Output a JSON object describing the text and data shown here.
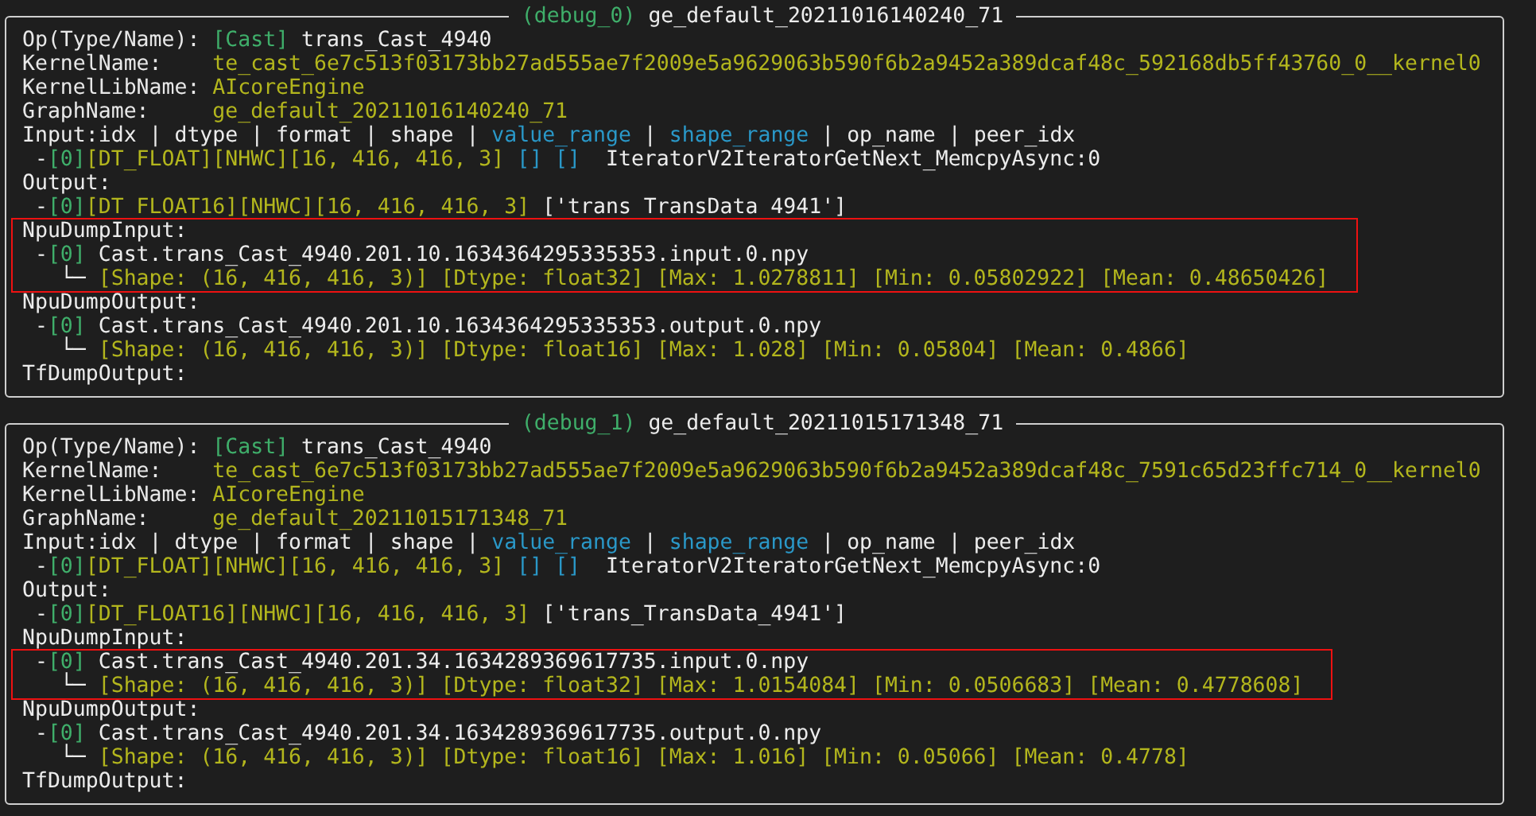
{
  "panels": [
    {
      "legend": [
        {
          "kind": "tag",
          "text": "(debug_0)"
        },
        {
          "kind": "plain",
          "text": "ge_default_20211016140240_71",
          "spaced": true
        }
      ],
      "lines": [
        {
          "kind": "header",
          "segments": [
            {
              "kind": "label",
              "text": "Op(Type/Name):"
            },
            {
              "kind": "tag",
              "text": "[Cast]"
            },
            {
              "kind": "plain",
              "text": "trans_Cast_4940",
              "spaced": true
            }
          ]
        },
        {
          "kind": "header",
          "segments": [
            {
              "kind": "label",
              "text": "KernelName:"
            },
            {
              "kind": "value",
              "text": "te_cast_6e7c513f03173bb27ad555ae7f2009e5a9629063b590f6b2a9452a389dcaf48c_592168db5ff43760_0__kernel0"
            }
          ]
        },
        {
          "kind": "header",
          "segments": [
            {
              "kind": "label",
              "text": "KernelLibName:"
            },
            {
              "kind": "value",
              "text": "AIcoreEngine"
            }
          ]
        },
        {
          "kind": "header",
          "segments": [
            {
              "kind": "label",
              "text": "GraphName:"
            },
            {
              "kind": "value",
              "text": "ge_default_20211016140240_71"
            }
          ]
        },
        {
          "kind": "header",
          "segments": [
            {
              "kind": "plain",
              "text": "Input:idx | dtype | format | shape |"
            },
            {
              "kind": "range",
              "text": "value_range",
              "spaced": true
            },
            {
              "kind": "plain",
              "text": "|",
              "spaced": true
            },
            {
              "kind": "range",
              "text": "shape_range",
              "spaced": true
            },
            {
              "kind": "plain",
              "text": "| op_name | peer_idx",
              "spaced": true
            }
          ]
        },
        {
          "kind": "item",
          "segments": [
            {
              "kind": "plain",
              "text": "-"
            },
            {
              "kind": "tag",
              "text": "[0]"
            },
            {
              "kind": "value",
              "text": "[DT_FLOAT][NHWC][16, 416, 416, 3]"
            },
            {
              "kind": "range",
              "text": "[] []",
              "spaced": true
            },
            {
              "kind": "plain",
              "text": "IteratorV2IteratorGetNext_MemcpyAsync:0",
              "spaced": true,
              "wide": true
            }
          ]
        },
        {
          "kind": "header",
          "segments": [
            {
              "kind": "plain",
              "text": "Output:"
            }
          ]
        },
        {
          "kind": "item",
          "segments": [
            {
              "kind": "plain",
              "text": "-"
            },
            {
              "kind": "tag",
              "text": "[0]"
            },
            {
              "kind": "value",
              "text": "[DT FLOAT16][NHWC][16, 416, 416, 3]"
            },
            {
              "kind": "plain",
              "text": "['trans TransData 4941']",
              "spaced": true
            }
          ]
        },
        {
          "kind": "highlight",
          "lines": [
            {
              "kind": "header",
              "segments": [
                {
                  "kind": "plain",
                  "text": "NpuDumpInput:"
                }
              ]
            },
            {
              "kind": "item",
              "segments": [
                {
                  "kind": "plain",
                  "text": "-"
                },
                {
                  "kind": "tag",
                  "text": "[0]"
                },
                {
                  "kind": "plain",
                  "text": "Cast.trans_Cast_4940.201.10.1634364295335353.input.0.npy",
                  "spaced": true
                }
              ]
            },
            {
              "kind": "detail",
              "segments": [
                {
                  "kind": "plain",
                  "text": "└─"
                },
                {
                  "kind": "value",
                  "text": "[Shape: (16, 416, 416, 3)] [Dtype: float32] [Max: 1.0278811] [Min: 0.05802922] [Mean: 0.48650426]",
                  "spaced": true
                }
              ]
            }
          ]
        },
        {
          "kind": "header",
          "segments": [
            {
              "kind": "plain",
              "text": "NpuDumpOutput:"
            }
          ]
        },
        {
          "kind": "item",
          "segments": [
            {
              "kind": "plain",
              "text": "-"
            },
            {
              "kind": "tag",
              "text": "[0]"
            },
            {
              "kind": "plain",
              "text": "Cast.trans_Cast_4940.201.10.1634364295335353.output.0.npy",
              "spaced": true
            }
          ]
        },
        {
          "kind": "detail",
          "segments": [
            {
              "kind": "plain",
              "text": "└─"
            },
            {
              "kind": "value",
              "text": "[Shape: (16, 416, 416, 3)] [Dtype: float16] [Max: 1.028] [Min: 0.05804] [Mean: 0.4866]",
              "spaced": true
            }
          ]
        },
        {
          "kind": "header",
          "segments": [
            {
              "kind": "plain",
              "text": "TfDumpOutput:"
            }
          ]
        }
      ]
    },
    {
      "legend": [
        {
          "kind": "tag",
          "text": "(debug_1)"
        },
        {
          "kind": "plain",
          "text": "ge_default_20211015171348_71",
          "spaced": true
        }
      ],
      "lines": [
        {
          "kind": "header",
          "segments": [
            {
              "kind": "label",
              "text": "Op(Type/Name):"
            },
            {
              "kind": "tag",
              "text": "[Cast]"
            },
            {
              "kind": "plain",
              "text": "trans_Cast_4940",
              "spaced": true
            }
          ]
        },
        {
          "kind": "header",
          "segments": [
            {
              "kind": "label",
              "text": "KernelName:"
            },
            {
              "kind": "value",
              "text": "te_cast_6e7c513f03173bb27ad555ae7f2009e5a9629063b590f6b2a9452a389dcaf48c_7591c65d23ffc714_0__kernel0"
            }
          ]
        },
        {
          "kind": "header",
          "segments": [
            {
              "kind": "label",
              "text": "KernelLibName:"
            },
            {
              "kind": "value",
              "text": "AIcoreEngine"
            }
          ]
        },
        {
          "kind": "header",
          "segments": [
            {
              "kind": "label",
              "text": "GraphName:"
            },
            {
              "kind": "value",
              "text": "ge_default_20211015171348_71"
            }
          ]
        },
        {
          "kind": "header",
          "segments": [
            {
              "kind": "plain",
              "text": "Input:idx | dtype | format | shape |"
            },
            {
              "kind": "range",
              "text": "value_range",
              "spaced": true
            },
            {
              "kind": "plain",
              "text": "|",
              "spaced": true
            },
            {
              "kind": "range",
              "text": "shape_range",
              "spaced": true
            },
            {
              "kind": "plain",
              "text": "| op_name | peer_idx",
              "spaced": true
            }
          ]
        },
        {
          "kind": "item",
          "segments": [
            {
              "kind": "plain",
              "text": "-"
            },
            {
              "kind": "tag",
              "text": "[0]"
            },
            {
              "kind": "value",
              "text": "[DT_FLOAT][NHWC][16, 416, 416, 3]"
            },
            {
              "kind": "range",
              "text": "[] []",
              "spaced": true
            },
            {
              "kind": "plain",
              "text": "IteratorV2IteratorGetNext_MemcpyAsync:0",
              "spaced": true,
              "wide": true
            }
          ]
        },
        {
          "kind": "header",
          "segments": [
            {
              "kind": "plain",
              "text": "Output:"
            }
          ]
        },
        {
          "kind": "item",
          "segments": [
            {
              "kind": "plain",
              "text": "-"
            },
            {
              "kind": "tag",
              "text": "[0]"
            },
            {
              "kind": "value",
              "text": "[DT_FLOAT16][NHWC][16, 416, 416, 3]"
            },
            {
              "kind": "plain",
              "text": "['trans_TransData_4941']",
              "spaced": true
            }
          ]
        },
        {
          "kind": "header",
          "segments": [
            {
              "kind": "plain",
              "text": "NpuDumpInput:"
            }
          ]
        },
        {
          "kind": "highlight",
          "lines": [
            {
              "kind": "item",
              "segments": [
                {
                  "kind": "plain",
                  "text": "-"
                },
                {
                  "kind": "tag",
                  "text": "[0]"
                },
                {
                  "kind": "plain",
                  "text": "Cast.trans_Cast_4940.201.34.1634289369617735.input.0.npy",
                  "spaced": true
                }
              ]
            },
            {
              "kind": "detail",
              "segments": [
                {
                  "kind": "plain",
                  "text": "└─"
                },
                {
                  "kind": "value",
                  "text": "[Shape: (16, 416, 416, 3)] [Dtype: float32] [Max: 1.0154084] [Min: 0.0506683] [Mean: 0.4778608]",
                  "spaced": true
                }
              ]
            }
          ]
        },
        {
          "kind": "header",
          "segments": [
            {
              "kind": "plain",
              "text": "NpuDumpOutput:"
            }
          ]
        },
        {
          "kind": "item",
          "segments": [
            {
              "kind": "plain",
              "text": "-"
            },
            {
              "kind": "tag",
              "text": "[0]"
            },
            {
              "kind": "plain",
              "text": "Cast.trans_Cast_4940.201.34.1634289369617735.output.0.npy",
              "spaced": true
            }
          ]
        },
        {
          "kind": "detail",
          "segments": [
            {
              "kind": "plain",
              "text": "└─"
            },
            {
              "kind": "value",
              "text": "[Shape: (16, 416, 416, 3)] [Dtype: float16] [Max: 1.016] [Min: 0.05066] [Mean: 0.4778]",
              "spaced": true
            }
          ]
        },
        {
          "kind": "header",
          "segments": [
            {
              "kind": "plain",
              "text": "TfDumpOutput:"
            }
          ]
        }
      ]
    }
  ]
}
